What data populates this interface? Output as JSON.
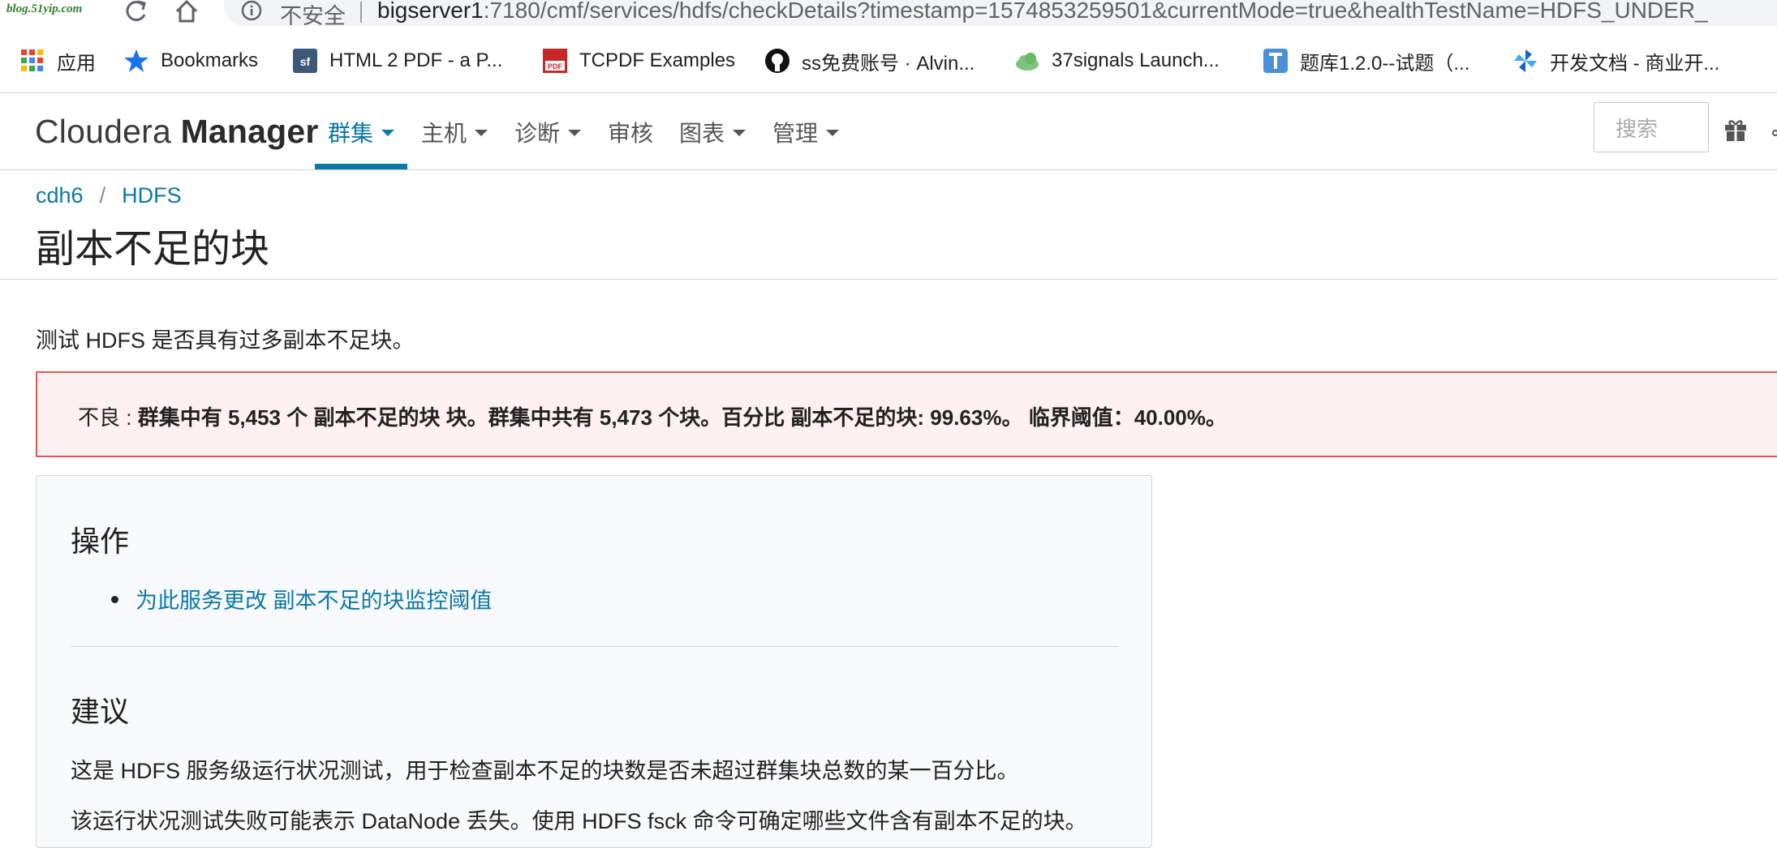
{
  "browser": {
    "watermark": "blog.51yip.com",
    "insecure_label": "不安全",
    "url_host": "bigserver1",
    "url_rest": ":7180/cmf/services/hdfs/checkDetails?timestamp=1574853259501&currentMode=true&healthTestName=HDFS_UNDER_",
    "bookmarks": [
      {
        "label": "应用",
        "icon": "apps-grid-icon"
      },
      {
        "label": "Bookmarks",
        "icon": "star-icon"
      },
      {
        "label": "HTML 2 PDF - a P...",
        "icon": "sf-icon"
      },
      {
        "label": "TCPDF Examples",
        "icon": "pdf-icon"
      },
      {
        "label": "ss免费账号 · Alvin...",
        "icon": "github-icon"
      },
      {
        "label": "37signals Launch...",
        "icon": "cloud-icon"
      },
      {
        "label": "题库1.2.0--试题（...",
        "icon": "tiku-icon"
      },
      {
        "label": "开发文档 - 商业开...",
        "icon": "pinwheel-icon"
      }
    ]
  },
  "header": {
    "logo_light": "Cloudera ",
    "logo_strong": "Manager",
    "nav": [
      {
        "label": "群集",
        "dropdown": true,
        "active": true
      },
      {
        "label": "主机",
        "dropdown": true
      },
      {
        "label": "诊断",
        "dropdown": true
      },
      {
        "label": "审核",
        "dropdown": false
      },
      {
        "label": "图表",
        "dropdown": true
      },
      {
        "label": "管理",
        "dropdown": true
      }
    ],
    "search_placeholder": "搜索",
    "accent_color": "#0a78a8"
  },
  "breadcrumb": {
    "items": [
      "cdh6",
      "HDFS"
    ],
    "separator": "/"
  },
  "page_title": "副本不足的块",
  "description": "测试 HDFS 是否具有过多副本不足块。",
  "alert": {
    "level": "不良",
    "separator": ":",
    "message": "群集中有 5,453 个 副本不足的块 块。群集中共有 5,473 个块。百分比 副本不足的块: 99.63%。 临界阈值：40.00%。",
    "border_color": "#e05a5a",
    "bg_color": "#fdf0f0"
  },
  "panel": {
    "actions_heading": "操作",
    "action_link": "为此服务更改 副本不足的块监控阈值",
    "advice_heading": "建议",
    "advice_paragraphs": [
      "这是 HDFS 服务级运行状况测试，用于检查副本不足的块数是否未超过群集块总数的某一百分比。",
      "该运行状况测试失败可能表示 DataNode 丢失。使用 HDFS fsck 命令可确定哪些文件含有副本不足的块。"
    ]
  }
}
